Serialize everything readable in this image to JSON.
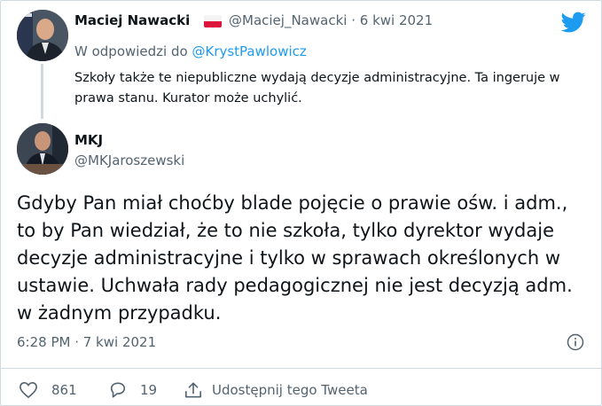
{
  "reply_tweet": {
    "author_name": "Maciej Nawacki",
    "handle": "@Maciej_Nawacki",
    "separator": "·",
    "date": "6 kwi 2021",
    "reply_prefix": "W odpowiedzi do",
    "reply_to": "@KrystPawlowicz",
    "text": "Szkoły także te niepubliczne wydają decyzje administracyjne. Ta ingeruje w prawa stanu. Kurator może uchylić."
  },
  "main_tweet": {
    "author_name": "MKJ",
    "handle": "@MKJaroszewski",
    "text": "Gdyby Pan miał choćby blade pojęcie o prawie ośw. i adm., to by Pan wiedział, że to nie szkoła, tylko dyrektor wydaje decyzje administracyjne i tylko w sprawach określonych w ustawie. Uchwała rady pedagogicznej nie jest decyzją adm. w żadnym przypadku.",
    "time": "6:28 PM · 7 kwi 2021",
    "likes": "861",
    "replies": "19",
    "share_label": "Udostępnij tego Tweeta"
  },
  "colors": {
    "accent": "#1d9bf0",
    "muted_text": "#536471",
    "divider": "#cfd9de"
  },
  "icons": [
    "twitter-bird-icon",
    "info-icon",
    "heart-icon",
    "reply-bubble-icon",
    "share-icon"
  ]
}
